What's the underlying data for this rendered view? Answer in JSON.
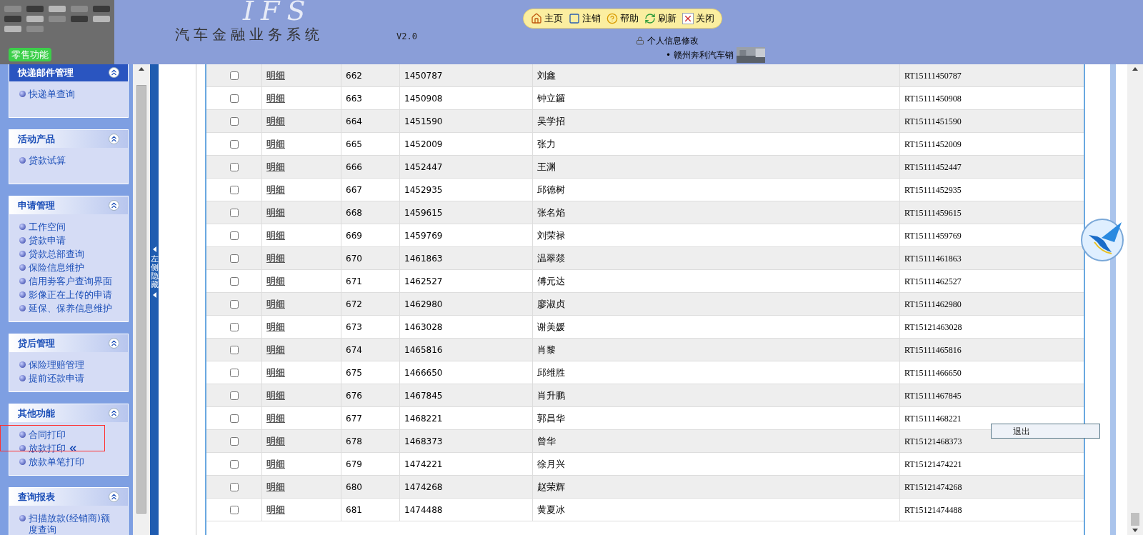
{
  "header": {
    "logo_text": "IFS",
    "title": "汽车金融业务系统",
    "version": "V2.0",
    "retail_label": "零售功能",
    "toolbar": [
      {
        "kind": "home",
        "label": "主页"
      },
      {
        "kind": "logout",
        "label": "注销"
      },
      {
        "kind": "help",
        "label": "帮助"
      },
      {
        "kind": "refresh",
        "label": "刷新"
      },
      {
        "kind": "close",
        "label": "关闭"
      }
    ],
    "profile_link": "个人信息修改",
    "dealer_bullet": "•",
    "dealer": "赣州奔利汽车销"
  },
  "sidebar": {
    "sections": [
      {
        "title": "快递邮件管理",
        "items": [
          {
            "label": "快递单查询",
            "selected": false
          }
        ]
      },
      {
        "title": "活动产品",
        "items": [
          {
            "label": "贷款试算",
            "selected": false
          }
        ]
      },
      {
        "title": "申请管理",
        "items": [
          {
            "label": "工作空间",
            "selected": false
          },
          {
            "label": "贷款申请",
            "selected": false
          },
          {
            "label": "贷款总部查询",
            "selected": false
          },
          {
            "label": "保险信息维护",
            "selected": false
          },
          {
            "label": "信用劵客户查询界面",
            "selected": false
          },
          {
            "label": "影像正在上传的申请",
            "selected": false
          },
          {
            "label": "延保、保养信息维护",
            "selected": false
          }
        ]
      },
      {
        "title": "贷后管理",
        "items": [
          {
            "label": "保险理赔管理",
            "selected": false
          },
          {
            "label": "提前还款申请",
            "selected": false
          }
        ]
      },
      {
        "title": "其他功能",
        "items": [
          {
            "label": "合同打印",
            "selected": false
          },
          {
            "label": "放款打印",
            "selected": true
          },
          {
            "label": "放款单笔打印",
            "selected": false
          }
        ]
      },
      {
        "title": "查询报表",
        "items": [
          {
            "label": "扫描放款(经销商)额度查询",
            "selected": false
          }
        ]
      }
    ]
  },
  "collapse_strip": {
    "label": "左侧隐藏"
  },
  "table": {
    "rows": [
      {
        "checked": false,
        "link": "明细",
        "index": "662",
        "id": "1450787",
        "name": "刘鑫",
        "contract": "RT15111450787"
      },
      {
        "checked": false,
        "link": "明细",
        "index": "663",
        "id": "1450908",
        "name": "钟立鑼",
        "contract": "RT15111450908"
      },
      {
        "checked": false,
        "link": "明细",
        "index": "664",
        "id": "1451590",
        "name": "吴学招",
        "contract": "RT15111451590"
      },
      {
        "checked": false,
        "link": "明细",
        "index": "665",
        "id": "1452009",
        "name": "张力",
        "contract": "RT15111452009"
      },
      {
        "checked": false,
        "link": "明细",
        "index": "666",
        "id": "1452447",
        "name": "王渊",
        "contract": "RT15111452447"
      },
      {
        "checked": false,
        "link": "明细",
        "index": "667",
        "id": "1452935",
        "name": "邱德树",
        "contract": "RT15111452935"
      },
      {
        "checked": false,
        "link": "明细",
        "index": "668",
        "id": "1459615",
        "name": "张名焰",
        "contract": "RT15111459615"
      },
      {
        "checked": false,
        "link": "明细",
        "index": "669",
        "id": "1459769",
        "name": "刘荣禄",
        "contract": "RT15111459769"
      },
      {
        "checked": false,
        "link": "明细",
        "index": "670",
        "id": "1461863",
        "name": "温翠燚",
        "contract": "RT15111461863"
      },
      {
        "checked": false,
        "link": "明细",
        "index": "671",
        "id": "1462527",
        "name": "傅元达",
        "contract": "RT15111462527"
      },
      {
        "checked": false,
        "link": "明细",
        "index": "672",
        "id": "1462980",
        "name": "廖淑贞",
        "contract": "RT15111462980"
      },
      {
        "checked": false,
        "link": "明细",
        "index": "673",
        "id": "1463028",
        "name": "谢美媛",
        "contract": "RT15121463028"
      },
      {
        "checked": false,
        "link": "明细",
        "index": "674",
        "id": "1465816",
        "name": "肖黎",
        "contract": "RT15111465816"
      },
      {
        "checked": false,
        "link": "明细",
        "index": "675",
        "id": "1466650",
        "name": "邱维胜",
        "contract": "RT15111466650"
      },
      {
        "checked": false,
        "link": "明细",
        "index": "676",
        "id": "1467845",
        "name": "肖升鹏",
        "contract": "RT15111467845"
      },
      {
        "checked": false,
        "link": "明细",
        "index": "677",
        "id": "1468221",
        "name": "郭昌华",
        "contract": "RT15111468221"
      },
      {
        "checked": false,
        "link": "明细",
        "index": "678",
        "id": "1468373",
        "name": "曾华",
        "contract": "RT15121468373"
      },
      {
        "checked": false,
        "link": "明细",
        "index": "679",
        "id": "1474221",
        "name": "徐月兴",
        "contract": "RT15121474221"
      },
      {
        "checked": false,
        "link": "明细",
        "index": "680",
        "id": "1474268",
        "name": "赵荣辉",
        "contract": "RT15121474268"
      },
      {
        "checked": false,
        "link": "明细",
        "index": "681",
        "id": "1474488",
        "name": "黄夏冰",
        "contract": "RT15121474488"
      }
    ]
  },
  "exit_button": "退出"
}
